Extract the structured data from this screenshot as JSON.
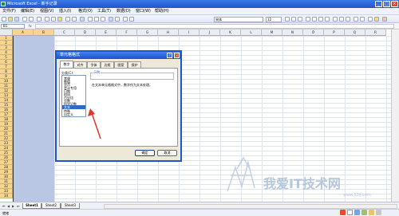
{
  "window": {
    "title": "Microsoft Excel - 新手记录"
  },
  "menu": {
    "items": [
      "文件(F)",
      "编辑(E)",
      "视图(V)",
      "插入(I)",
      "格式(O)",
      "工具(T)",
      "数据(D)",
      "窗口(W)",
      "帮助(H)"
    ],
    "help_placeholder": "键入需要帮助的问题"
  },
  "toolbar": {
    "font_name": "宋体",
    "font_size": "12"
  },
  "formula": {
    "name_box": "B1",
    "fx": "fx",
    "value": ""
  },
  "grid": {
    "columns": [
      "A",
      "B",
      "C",
      "D",
      "E",
      "F",
      "G",
      "H",
      "I",
      "J",
      "K",
      "L",
      "M",
      "N",
      "O",
      "P",
      "Q",
      "R"
    ],
    "selected_columns": [
      "A",
      "B"
    ],
    "rows": [
      "1",
      "2",
      "3",
      "4",
      "5",
      "6",
      "7",
      "8",
      "9",
      "10",
      "11",
      "12",
      "13",
      "14",
      "15",
      "16",
      "17",
      "18",
      "19",
      "20",
      "21",
      "22",
      "23",
      "24",
      "25",
      "26",
      "27",
      "28",
      "29",
      "30",
      "31",
      "32",
      "33",
      "34"
    ]
  },
  "sheets": {
    "tabs": [
      "Sheet1",
      "Sheet2",
      "Sheet3"
    ],
    "active": "Sheet1"
  },
  "status": {
    "text": "就绪"
  },
  "dialog": {
    "title": "单元格格式",
    "tabs": [
      "数字",
      "对齐",
      "字体",
      "边框",
      "图案",
      "保护"
    ],
    "active_tab": "数字",
    "category_label": "分类(C):",
    "categories": [
      "常规",
      "数值",
      "货币",
      "会计专用",
      "日期",
      "时间",
      "百分比",
      "分数",
      "科学记数",
      "文本",
      "特殊",
      "自定义"
    ],
    "selected_category": "文本",
    "sample_label": "示例",
    "description": "在文本单元格格式中，数字作为文本处理。",
    "ok": "确定",
    "cancel": "取消"
  },
  "watermark": {
    "text": "我爱IT技术网",
    "url": "www.52ij.com"
  },
  "colors": {
    "titlebar": "#1f55c9",
    "selection": "#b9c6e4",
    "header_highlight": "#f7d58c",
    "arrow": "#e3342f"
  }
}
